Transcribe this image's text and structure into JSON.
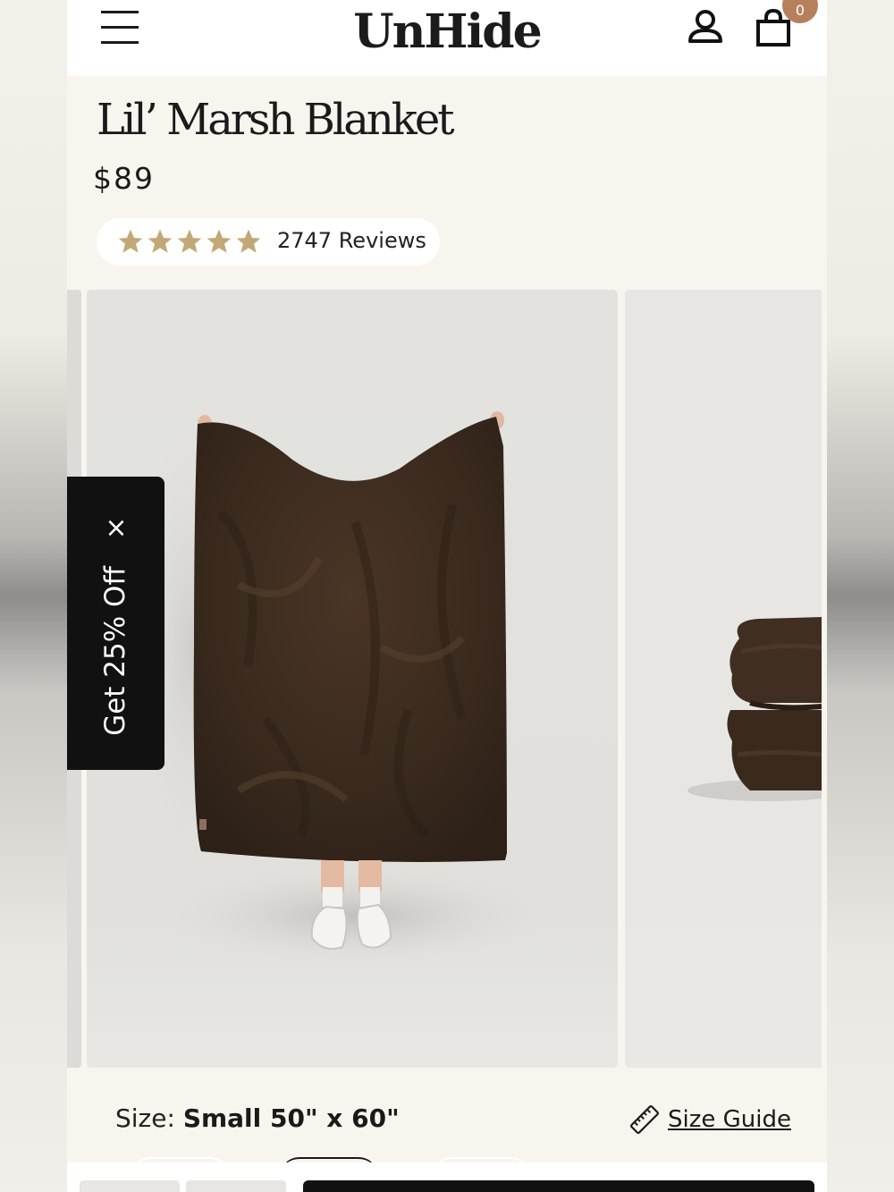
{
  "header": {
    "logo": "UnHide",
    "cart_count": "0",
    "icons": {
      "menu": "hamburger-menu-icon",
      "account": "user-icon",
      "cart": "shopping-bag-icon"
    }
  },
  "product": {
    "title": "Lil’ Marsh Blanket",
    "price": "$89",
    "rating": 5,
    "reviews_label": "2747 Reviews",
    "star_color": "#c3a877"
  },
  "promo": {
    "label": "Get 25% Off",
    "close_symbol": "×"
  },
  "size": {
    "label": "Size: ",
    "value": "Small 50\" x 60\"",
    "guide_label": "Size Guide",
    "guide_icon": "ruler-icon"
  },
  "colors": {
    "accent": "#b7805c",
    "blanket": "#3b2a1f",
    "dark": "#111111"
  }
}
